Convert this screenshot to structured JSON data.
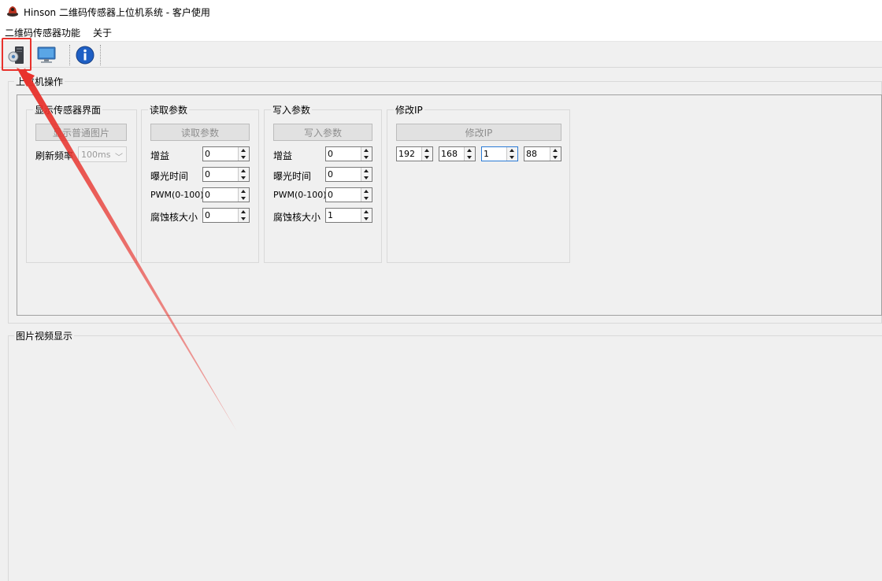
{
  "window": {
    "title": "Hinson 二维码传感器上位机系统 - 客户使用"
  },
  "menu": {
    "items": [
      "二维码传感器功能",
      "关于"
    ]
  },
  "toolbar": {
    "buttons": [
      {
        "icon": "server-settings-icon"
      },
      {
        "icon": "monitor-icon"
      },
      {
        "icon": "info-icon",
        "glyph": "i"
      }
    ]
  },
  "host_panel": {
    "title": "上位机操作",
    "display": {
      "title": "显示传感器界面",
      "button": "显示普通图片",
      "refresh_label": "刷新频率",
      "refresh_value": "100ms"
    },
    "read": {
      "title": "读取参数",
      "button": "读取参数",
      "fields": [
        {
          "label": "增益",
          "value": "0"
        },
        {
          "label": "曝光时间",
          "value": "0"
        },
        {
          "label": "PWM(0-100)",
          "value": "0"
        },
        {
          "label": "腐蚀核大小",
          "value": "0"
        }
      ]
    },
    "write": {
      "title": "写入参数",
      "button": "写入参数",
      "fields": [
        {
          "label": "增益",
          "value": "0"
        },
        {
          "label": "曝光时间",
          "value": "0"
        },
        {
          "label": "PWM(0-100)",
          "value": "0"
        },
        {
          "label": "腐蚀核大小",
          "value": "1"
        }
      ]
    },
    "ip": {
      "title": "修改IP",
      "button": "修改IP",
      "octets": [
        "192",
        "168",
        "1",
        "88"
      ]
    }
  },
  "image_panel": {
    "title": "图片视频显示"
  },
  "colors": {
    "highlight": "#e8322c",
    "info_blue": "#1e5fc4"
  }
}
